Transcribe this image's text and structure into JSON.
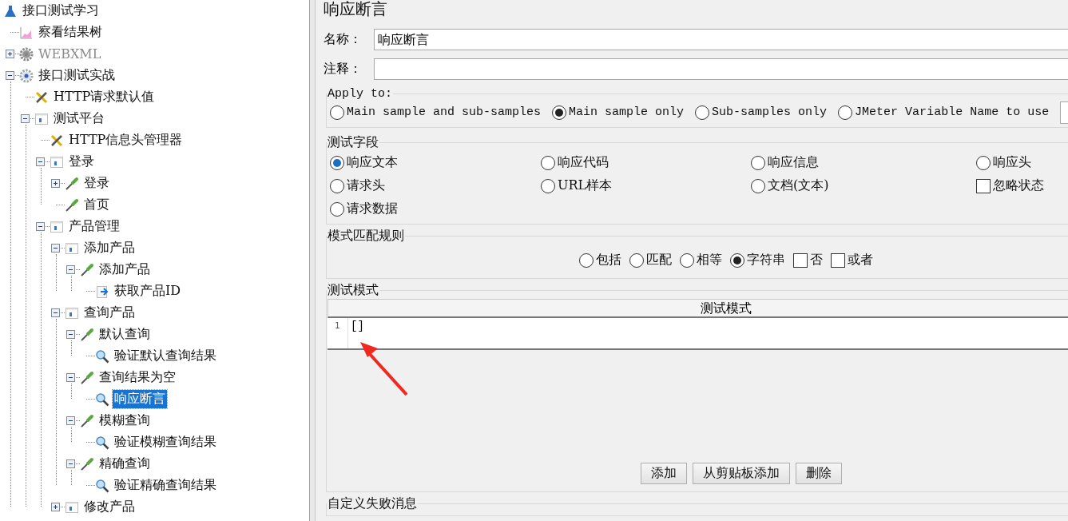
{
  "tree": {
    "root": {
      "label": "接口测试学习",
      "kind": "plan",
      "selected": false,
      "disabled": false,
      "children": [
        {
          "label": "察看结果树",
          "kind": "graph",
          "selected": false,
          "disabled": false
        },
        {
          "label": "WEBXML",
          "kind": "gear",
          "selected": false,
          "disabled": true,
          "expanded": false
        },
        {
          "label": "接口测试实战",
          "kind": "gear",
          "selected": false,
          "disabled": false,
          "expanded": true,
          "children": [
            {
              "label": "HTTP请求默认值",
              "kind": "tools",
              "selected": false,
              "disabled": false
            },
            {
              "label": "测试平台",
              "kind": "controller",
              "selected": false,
              "disabled": false,
              "expanded": true,
              "children": [
                {
                  "label": "HTTP信息头管理器",
                  "kind": "tools",
                  "selected": false,
                  "disabled": false
                },
                {
                  "label": "登录",
                  "kind": "controller",
                  "selected": false,
                  "disabled": false,
                  "expanded": true,
                  "children": [
                    {
                      "label": "登录",
                      "kind": "sampler",
                      "selected": false,
                      "disabled": false,
                      "expanded": false
                    },
                    {
                      "label": "首页",
                      "kind": "sampler",
                      "selected": false,
                      "disabled": false
                    }
                  ]
                },
                {
                  "label": "产品管理",
                  "kind": "controller",
                  "selected": false,
                  "disabled": false,
                  "expanded": true,
                  "children": [
                    {
                      "label": "添加产品",
                      "kind": "controller",
                      "selected": false,
                      "disabled": false,
                      "expanded": true,
                      "children": [
                        {
                          "label": "添加产品",
                          "kind": "sampler",
                          "selected": false,
                          "disabled": false,
                          "expanded": true,
                          "children": [
                            {
                              "label": "获取产品ID",
                              "kind": "extractor",
                              "selected": false,
                              "disabled": false
                            }
                          ]
                        }
                      ]
                    },
                    {
                      "label": "查询产品",
                      "kind": "controller",
                      "selected": false,
                      "disabled": false,
                      "expanded": true,
                      "children": [
                        {
                          "label": "默认查询",
                          "kind": "sampler",
                          "selected": false,
                          "disabled": false,
                          "expanded": true,
                          "children": [
                            {
                              "label": "验证默认查询结果",
                              "kind": "assertion",
                              "selected": false,
                              "disabled": false
                            }
                          ]
                        },
                        {
                          "label": "查询结果为空",
                          "kind": "sampler",
                          "selected": false,
                          "disabled": false,
                          "expanded": true,
                          "children": [
                            {
                              "label": "响应断言",
                              "kind": "assertion",
                              "selected": true,
                              "disabled": false
                            }
                          ]
                        },
                        {
                          "label": "模糊查询",
                          "kind": "sampler",
                          "selected": false,
                          "disabled": false,
                          "expanded": true,
                          "children": [
                            {
                              "label": "验证模糊查询结果",
                              "kind": "assertion",
                              "selected": false,
                              "disabled": false
                            }
                          ]
                        },
                        {
                          "label": "精确查询",
                          "kind": "sampler",
                          "selected": false,
                          "disabled": false,
                          "expanded": true,
                          "children": [
                            {
                              "label": "验证精确查询结果",
                              "kind": "assertion",
                              "selected": false,
                              "disabled": false
                            }
                          ]
                        }
                      ]
                    },
                    {
                      "label": "修改产品",
                      "kind": "controller",
                      "selected": false,
                      "disabled": false,
                      "expanded": false
                    }
                  ]
                }
              ]
            }
          ]
        }
      ]
    }
  },
  "editor": {
    "title": "响应断言",
    "name_label": "名称：",
    "name_value": "响应断言",
    "comment_label": "注释：",
    "apply_to": {
      "legend": "Apply to:",
      "options": [
        {
          "label": "Main sample and sub-samples",
          "selected": false
        },
        {
          "label": "Main sample only",
          "selected": true
        },
        {
          "label": "Sub-samples only",
          "selected": false
        },
        {
          "label": "JMeter Variable Name to use",
          "selected": false
        }
      ]
    },
    "test_field": {
      "legend": "测试字段",
      "options": [
        {
          "kind": "radio",
          "label": "响应文本",
          "selected": true
        },
        {
          "kind": "radio",
          "label": "响应代码",
          "selected": false
        },
        {
          "kind": "radio",
          "label": "响应信息",
          "selected": false
        },
        {
          "kind": "radio",
          "label": "响应头",
          "selected": false
        },
        {
          "kind": "radio",
          "label": "请求头",
          "selected": false
        },
        {
          "kind": "radio",
          "label": "URL样本",
          "selected": false
        },
        {
          "kind": "radio",
          "label": "文档(文本)",
          "selected": false
        },
        {
          "kind": "checkbox",
          "label": "忽略状态",
          "checked": false
        },
        {
          "kind": "radio",
          "label": "请求数据",
          "selected": false
        }
      ]
    },
    "pattern_rules": {
      "legend": "模式匹配规则",
      "options": [
        {
          "kind": "radio",
          "label": "包括",
          "selected": false
        },
        {
          "kind": "radio",
          "label": "匹配",
          "selected": false
        },
        {
          "kind": "radio",
          "label": "相等",
          "selected": false
        },
        {
          "kind": "radio",
          "label": "字符串",
          "selected": true
        },
        {
          "kind": "checkbox",
          "label": "否",
          "checked": false
        },
        {
          "kind": "checkbox",
          "label": "或者",
          "checked": false
        }
      ]
    },
    "patterns": {
      "legend": "测试模式",
      "column": "测试模式",
      "rows": [
        {
          "line": "1",
          "text": "[]"
        }
      ],
      "buttons": [
        "添加",
        "从剪贴板添加",
        "删除"
      ]
    },
    "failure_message": {
      "legend": "自定义失败消息"
    }
  }
}
